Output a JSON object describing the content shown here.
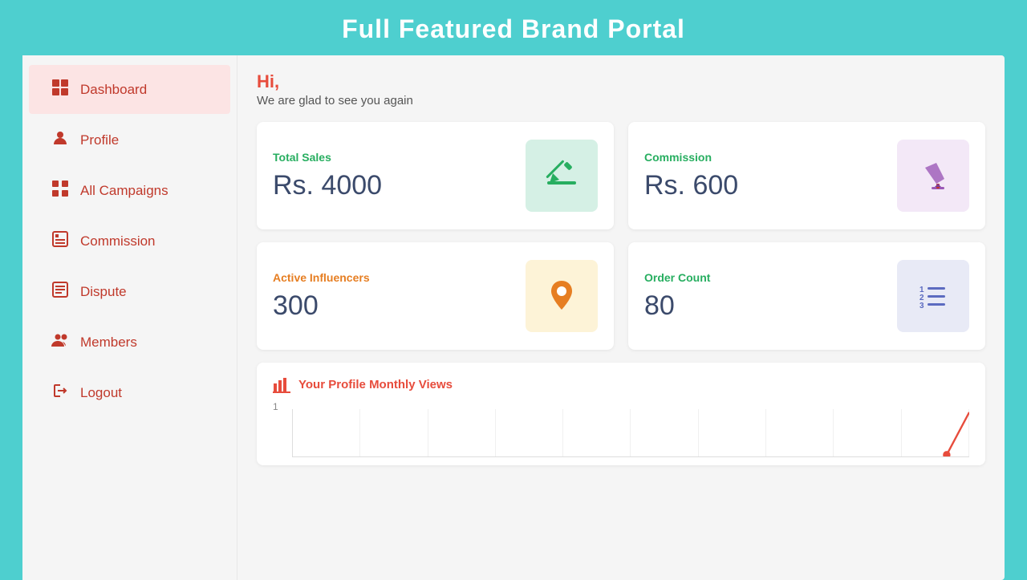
{
  "header": {
    "title": "Full Featured Brand Portal"
  },
  "greeting": {
    "hi": "Hi,",
    "subtitle": "We are glad to see you again"
  },
  "sidebar": {
    "items": [
      {
        "id": "dashboard",
        "label": "Dashboard",
        "icon": "⊞",
        "active": true
      },
      {
        "id": "profile",
        "label": "Profile",
        "icon": "👤",
        "active": false
      },
      {
        "id": "all-campaigns",
        "label": "All Campaigns",
        "icon": "⊞",
        "active": false
      },
      {
        "id": "commission",
        "label": "Commission",
        "icon": "🗂",
        "active": false
      },
      {
        "id": "dispute",
        "label": "Dispute",
        "icon": "📋",
        "active": false
      },
      {
        "id": "members",
        "label": "Members",
        "icon": "👥",
        "active": false
      },
      {
        "id": "logout",
        "label": "Logout",
        "icon": "⏻",
        "active": false
      }
    ]
  },
  "stats": {
    "cards": [
      {
        "id": "total-sales",
        "label": "Total Sales",
        "value": "Rs. 4000",
        "icon_color": "green",
        "label_color": "green"
      },
      {
        "id": "commission",
        "label": "Commission",
        "value": "Rs. 600",
        "icon_color": "purple",
        "label_color": "green"
      },
      {
        "id": "active-influencers",
        "label": "Active Influencers",
        "value": "300",
        "icon_color": "yellow",
        "label_color": "orange"
      },
      {
        "id": "order-count",
        "label": "Order Count",
        "value": "80",
        "icon_color": "blue-light",
        "label_color": "green"
      }
    ]
  },
  "chart": {
    "title": "Your Profile Monthly Views",
    "y_label": "1"
  }
}
